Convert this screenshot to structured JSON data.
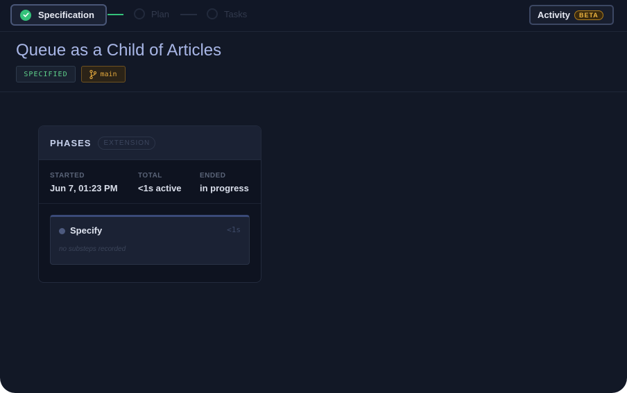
{
  "steps": [
    {
      "label": "Specification",
      "state": "complete"
    },
    {
      "label": "Plan",
      "state": "pending"
    },
    {
      "label": "Tasks",
      "state": "pending"
    }
  ],
  "activity": {
    "label": "Activity",
    "badge": "BETA"
  },
  "page": {
    "title": "Queue as a Child of Articles",
    "status_badge": "SPECIFIED",
    "branch": "main"
  },
  "phases": {
    "title": "PHASES",
    "badge": "EXTENSION",
    "stats": [
      {
        "key": "STARTED",
        "value": "Jun 7, 01:23 PM"
      },
      {
        "key": "TOTAL",
        "value": "<1s active"
      },
      {
        "key": "ENDED",
        "value": "in progress"
      }
    ],
    "items": [
      {
        "name": "Specify",
        "duration": "<1s",
        "empty_text": "no substeps recorded"
      }
    ]
  },
  "colors": {
    "background": "#121826",
    "success": "#34c27a",
    "branch": "#e0a63c",
    "title": "#a8b6e6"
  },
  "icons": [
    "check-icon",
    "git-branch-icon",
    "status-dot-icon"
  ]
}
